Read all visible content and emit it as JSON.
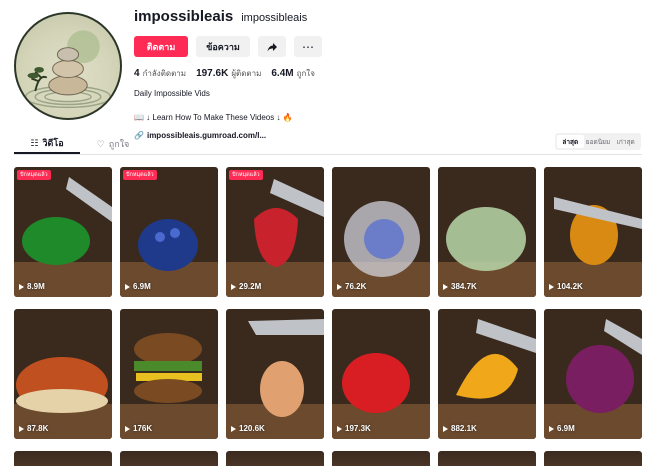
{
  "profile": {
    "username": "impossibleais",
    "nickname": "impossibleais",
    "follow_label": "ติดตาม",
    "message_label": "ข้อความ",
    "share_icon": "share-icon",
    "more_icon": "more-icon",
    "stats": [
      {
        "value": "4",
        "label": "กำลังติดตาม"
      },
      {
        "value": "197.6K",
        "label": "ผู้ติดตาม"
      },
      {
        "value": "6.4M",
        "label": "ถูกใจ"
      }
    ],
    "bio_line1": "Daily Impossible Vids",
    "bio_line2": "📖 ↓ Learn How To Make These Videos ↓ 🔥",
    "link": "impossibleais.gumroad.com/l..."
  },
  "tabs": [
    {
      "label": "วิดีโอ",
      "icon": "grid-icon"
    },
    {
      "label": "ถูกใจ",
      "icon": "heart-icon"
    }
  ],
  "sort": [
    "ล่าสุด",
    "ยอดนิยม",
    "เก่าสุด"
  ],
  "badge_label": "ปักหมุดแล้ว",
  "videos": [
    {
      "views": "8.9M",
      "pinned": true,
      "color": "#1f8a2a"
    },
    {
      "views": "6.9M",
      "pinned": true,
      "color": "#1f3a8a"
    },
    {
      "views": "29.2M",
      "pinned": true,
      "color": "#c8232c"
    },
    {
      "views": "76.2K",
      "pinned": false,
      "color": "#6b7cc8"
    },
    {
      "views": "384.7K",
      "pinned": false,
      "color": "#b8d7a8"
    },
    {
      "views": "104.2K",
      "pinned": false,
      "color": "#d98a12"
    },
    {
      "views": "87.8K",
      "pinned": false,
      "color": "#c0501f"
    },
    {
      "views": "176K",
      "pinned": false,
      "color": "#4b8a2a"
    },
    {
      "views": "120.6K",
      "pinned": false,
      "color": "#e0a070"
    },
    {
      "views": "197.3K",
      "pinned": false,
      "color": "#d81e22"
    },
    {
      "views": "882.1K",
      "pinned": false,
      "color": "#f0a81a"
    },
    {
      "views": "6.9M",
      "pinned": false,
      "color": "#7a1e62"
    }
  ]
}
